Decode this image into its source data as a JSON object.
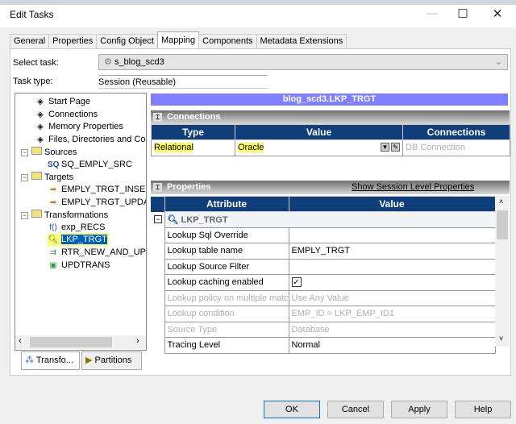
{
  "window": {
    "title": "Edit Tasks",
    "minimize": "—",
    "maximize": "☐",
    "close": "✕"
  },
  "tabs": [
    "General",
    "Properties",
    "Config Object",
    "Mapping",
    "Components",
    "Metadata Extensions"
  ],
  "select_task": {
    "label": "Select task:",
    "value": "s_blog_scd3"
  },
  "task_type": {
    "label": "Task type:",
    "value": "Session (Reusable)"
  },
  "tree": {
    "start_page": "Start Page",
    "connections": "Connections",
    "memory": "Memory Properties",
    "files": "Files, Directories and Commands",
    "sources": "Sources",
    "sq": "SQ_EMPLY_SRC",
    "targets": "Targets",
    "t1": "EMPLY_TRGT_INSERT",
    "t2": "EMPLY_TRGT_UPDATE",
    "transformations": "Transformations",
    "x1": "exp_RECS",
    "x2": "LKP_TRGT",
    "x3": "RTR_NEW_AND_UPDATE",
    "x4": "UPDTRANS"
  },
  "bottom_tabs": {
    "transformations": "Transfo...",
    "partitions": "Partitions"
  },
  "panel": {
    "title": "blog_scd3.LKP_TRGT",
    "connections": {
      "header": "Connections",
      "cols": [
        "Type",
        "Value",
        "Connections"
      ],
      "row": [
        "Relational",
        "Oracle",
        "DB Connection"
      ]
    },
    "properties": {
      "header": "Properties",
      "link": "Show Session Level Properties",
      "cols": [
        "Attribute",
        "Value"
      ],
      "group": "LKP_TRGT",
      "rows": [
        {
          "a": "Lookup Sql Override",
          "v": ""
        },
        {
          "a": "Lookup table name",
          "v": "EMPLY_TRGT"
        },
        {
          "a": "Lookup Source Filter",
          "v": ""
        },
        {
          "a": "Lookup caching enabled",
          "v": "",
          "check": true
        },
        {
          "a": "Lookup policy on multiple match",
          "v": "Use Any Value",
          "dis": true
        },
        {
          "a": "Lookup condition",
          "v": "EMP_ID = LKP_EMP_ID1",
          "dis": true
        },
        {
          "a": "Source Type",
          "v": "Database",
          "dis": true
        },
        {
          "a": "Tracing Level",
          "v": "Normal"
        }
      ]
    }
  },
  "buttons": {
    "ok": "OK",
    "cancel": "Cancel",
    "apply": "Apply",
    "help": "Help"
  }
}
